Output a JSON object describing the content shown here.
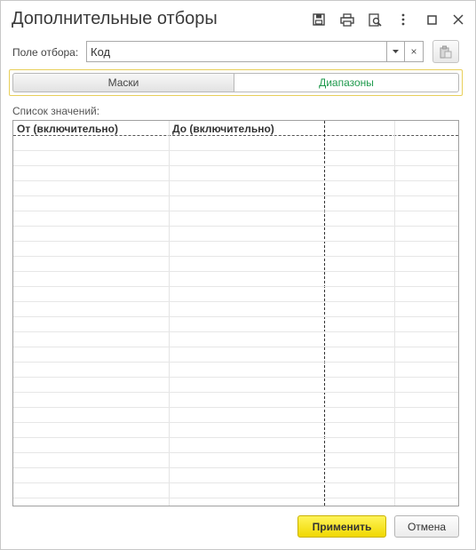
{
  "window": {
    "title": "Дополнительные отборы",
    "toolbar_icons": [
      "save-icon",
      "print-icon",
      "preview-icon",
      "more-icon",
      "maximize-icon",
      "close-icon"
    ]
  },
  "filter_field": {
    "label": "Поле отбора:",
    "value": "Код",
    "dropdown_icon": "chevron-down-icon",
    "clear_label": "×",
    "paste_icon": "clipboard-icon"
  },
  "tabs": [
    {
      "label": "Маски",
      "active": false
    },
    {
      "label": "Диапазоны",
      "active": true
    }
  ],
  "values_list": {
    "label": "Список значений:",
    "columns": [
      "От (включительно)",
      "До (включительно)",
      "",
      ""
    ],
    "rows": []
  },
  "buttons": {
    "apply": "Применить",
    "cancel": "Отмена"
  },
  "colors": {
    "accent_yellow": "#f5e100",
    "active_tab_text": "#1f9a4d",
    "tab_frame": "#e8cf5a"
  }
}
